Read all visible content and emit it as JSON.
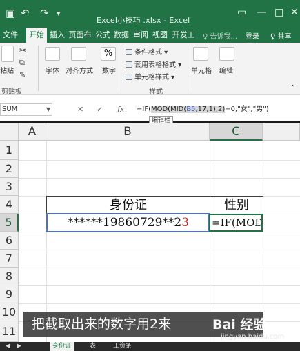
{
  "window": {
    "title": "Excel小技巧 .xlsx - Excel",
    "qat": {
      "save_icon": "save-icon",
      "undo_icon": "undo-icon",
      "redo_icon": "redo-icon",
      "customize_icon": "customize-qat-icon"
    }
  },
  "tabs": [
    {
      "label": "文件"
    },
    {
      "label": "开始"
    },
    {
      "label": "插入"
    },
    {
      "label": "页面布"
    },
    {
      "label": "公式"
    },
    {
      "label": "数据"
    },
    {
      "label": "审阅"
    },
    {
      "label": "视图"
    },
    {
      "label": "开发工"
    }
  ],
  "active_tab": "开始",
  "tell_me": "♀ 告诉我...",
  "login": "登录",
  "share": "♀ 共享",
  "ribbon": {
    "paste": "粘贴",
    "font": "字体",
    "alignment": "对齐方式",
    "number": "数字",
    "number_symbol": "%",
    "conditional": "条件格式",
    "table_format": "套用表格格式",
    "cell_style": "单元格样式",
    "styles_group": "样式",
    "cells": "单元格",
    "editing": "编辑",
    "clipboard_group": "剪贴板"
  },
  "formula_bar": {
    "name_box": "SUM",
    "cancel": "✕",
    "enter": "✓",
    "fx": "fx",
    "formula_pre": "=IF(",
    "formula_hl1": "MOD(MID(",
    "formula_ref": "B5",
    "formula_hl2": ",17,1),2)",
    "formula_post": "=0,\"女\",\"男\")",
    "tooltip": "编辑栏"
  },
  "columns": [
    {
      "label": "A"
    },
    {
      "label": "B"
    },
    {
      "label": "C"
    }
  ],
  "rows": [
    "1",
    "2",
    "3",
    "4",
    "5",
    "6",
    "7",
    "8",
    "9",
    "10",
    "11"
  ],
  "table": {
    "header_b": "身份证",
    "header_c": "性别",
    "id_prefix": "******19860729**2",
    "id_digit": "3",
    "formula_display": "=IF(MOD"
  },
  "subtitle": "把截取出来的数字用2来",
  "watermark": {
    "brand": "Bai 经验",
    "url": "jingyan.baidu.com"
  },
  "sheets": [
    {
      "label": "身份证"
    },
    {
      "label": "表"
    },
    {
      "label": "工资条"
    }
  ]
}
